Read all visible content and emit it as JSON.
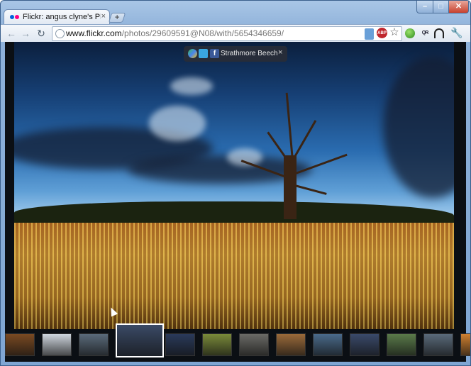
{
  "browser": {
    "tab_title": "Flickr: angus clyne's Photos",
    "tab_close": "×",
    "new_tab": "+",
    "url_host": "www.flickr.com",
    "url_path": "/photos/29609591@N08/with/5654346659/",
    "window_controls": {
      "minimize": "–",
      "maximize": "□",
      "close": "✕"
    },
    "nav_icons": [
      "back-icon",
      "forward-icon",
      "reload-icon"
    ],
    "extensions": {
      "adblock": "ABP",
      "qr": "QR",
      "bookmark_star": "☆"
    }
  },
  "photo_overlay": {
    "title": "Strathmore Beech",
    "close": "×",
    "share_icons": [
      "buzz-icon",
      "twitter-icon",
      "facebook-icon"
    ]
  },
  "filmstrip": {
    "selected_index": 3,
    "thumb_colors": [
      "#7a4a22",
      "#cfd6de",
      "#5a6a7a",
      "#3a4a66",
      "#2a3a5a",
      "#7a8a3a",
      "#6a6a66",
      "#9a6a3a",
      "#4a6a8a",
      "#3a4a6a",
      "#5a7a4a",
      "#5a6a7a",
      "#d08030"
    ]
  },
  "colors": {
    "window_frame": "#8fb2da",
    "content_bg": "#0b0f14"
  }
}
